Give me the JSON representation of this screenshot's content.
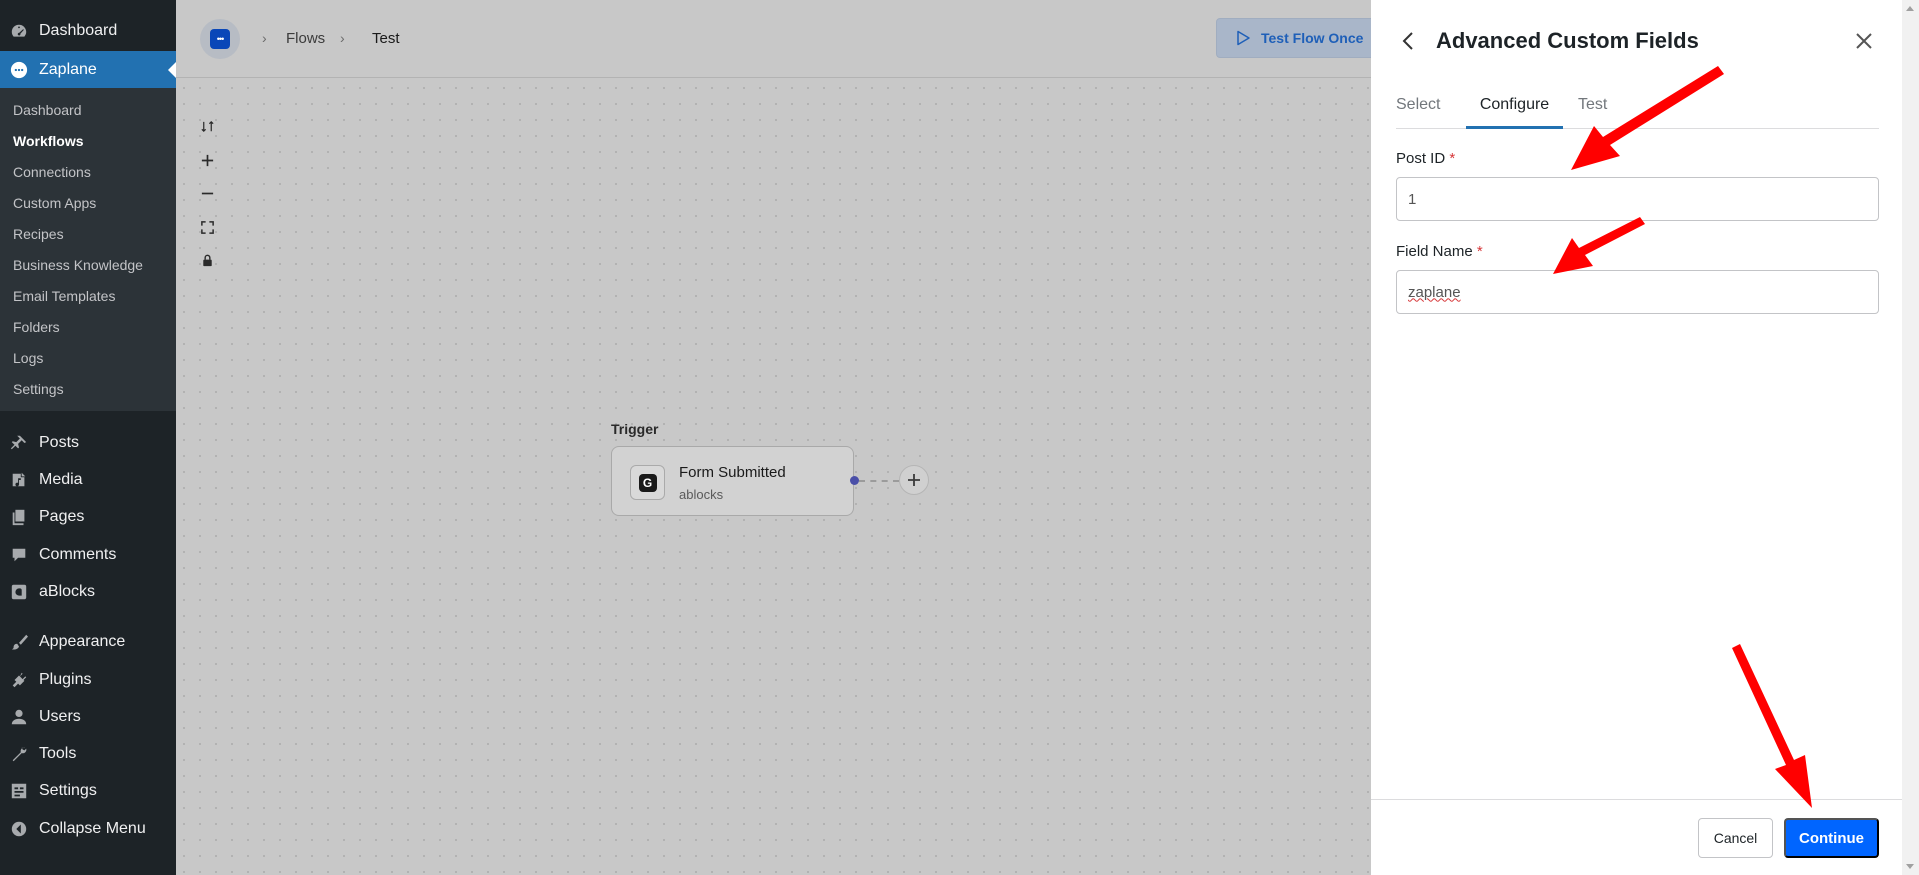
{
  "wp_menu": {
    "top": [
      {
        "label": "Dashboard",
        "icon": "dashboard-icon"
      },
      {
        "label": "Zaplane",
        "icon": "zaplane-icon"
      }
    ],
    "submenu": [
      "Dashboard",
      "Workflows",
      "Connections",
      "Custom Apps",
      "Recipes",
      "Business Knowledge",
      "Email Templates",
      "Folders",
      "Logs",
      "Settings"
    ],
    "submenu_current": "Workflows",
    "items": [
      {
        "label": "Posts",
        "icon": "pin-icon"
      },
      {
        "label": "Media",
        "icon": "media-icon"
      },
      {
        "label": "Pages",
        "icon": "pages-icon"
      },
      {
        "label": "Comments",
        "icon": "comment-icon"
      },
      {
        "label": "aBlocks",
        "icon": "ablocks-icon"
      },
      {
        "label": "Appearance",
        "icon": "brush-icon"
      },
      {
        "label": "Plugins",
        "icon": "plug-icon"
      },
      {
        "label": "Users",
        "icon": "user-icon"
      },
      {
        "label": "Tools",
        "icon": "wrench-icon"
      },
      {
        "label": "Settings",
        "icon": "settings-icon"
      },
      {
        "label": "Collapse Menu",
        "icon": "collapse-icon"
      }
    ]
  },
  "header": {
    "breadcrumb": [
      "Flows",
      "Test"
    ],
    "test_flow_label": "Test Flow Once"
  },
  "canvas": {
    "trigger_label": "Trigger",
    "node_title": "Form Submitted",
    "node_subtitle": "ablocks"
  },
  "drawer": {
    "title": "Advanced Custom Fields",
    "tabs": [
      "Select",
      "Configure",
      "Test"
    ],
    "active_tab": "Configure",
    "fields": [
      {
        "label": "Post ID",
        "required_mark": "*",
        "value": "1"
      },
      {
        "label": "Field Name",
        "required_mark": "*",
        "value": "zaplane"
      }
    ],
    "cancel_label": "Cancel",
    "continue_label": "Continue"
  },
  "colors": {
    "wp_sidebar": "#1d2327",
    "wp_active": "#2271b1",
    "primary_button": "#0065ff",
    "annotation_arrow": "#ff0000"
  }
}
